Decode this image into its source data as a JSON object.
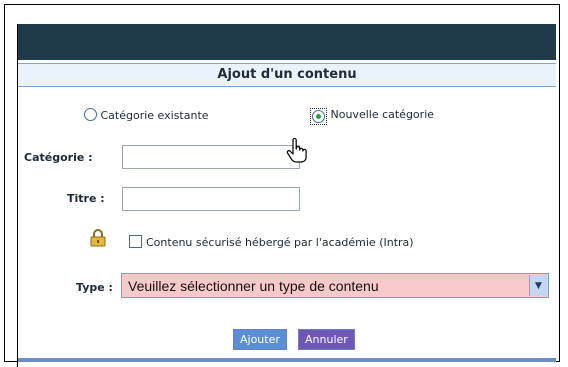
{
  "form": {
    "title": "Ajout d'un contenu",
    "radio_existing_label": "Catégorie existante",
    "radio_new_label": "Nouvelle catégorie",
    "category_label": "Catégorie :",
    "title_label": "Titre :",
    "secure_label": "Contenu sécurisé hébergé par l'académie (Intra)",
    "type_label": "Type :",
    "type_value": "Veuillez sélectionner un type de contenu",
    "submit_label": "Ajouter",
    "cancel_label": "Annuler"
  },
  "icons": {
    "lock": "lock-icon",
    "select_arrow": "chevron-down-icon",
    "cursor": "hand-pointer-icon"
  },
  "colors": {
    "header": "#1f3a4a",
    "title_bg": "#eaf2fb",
    "select_bg": "#f9c9c9",
    "button_ajouter": "#5a8fd6",
    "button_annuler": "#6e57b5"
  }
}
